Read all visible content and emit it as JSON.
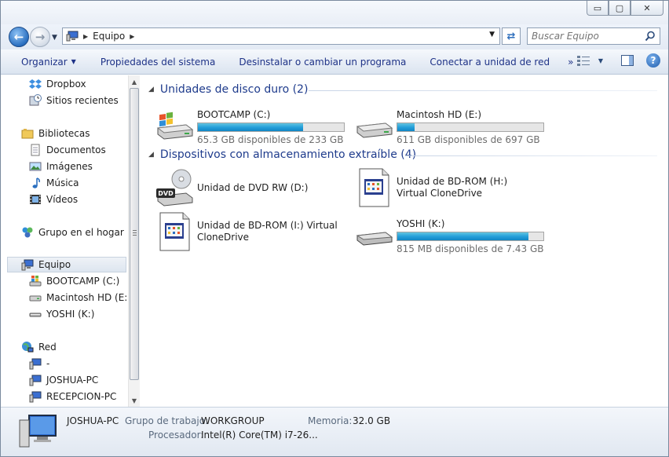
{
  "window": {
    "buttons": {
      "minimize": "▭",
      "maximize": "▢",
      "close": "✕"
    }
  },
  "address": {
    "back_icon": "back-arrow-icon",
    "forward_icon": "forward-arrow-icon",
    "path": "Equipo",
    "search_placeholder": "Buscar Equipo"
  },
  "commandbar": {
    "organize": "Organizar",
    "items": [
      "Propiedades del sistema",
      "Desinstalar o cambiar un programa",
      "Conectar a unidad de red"
    ],
    "more": "»"
  },
  "sidebar": {
    "favorites": [
      "Dropbox",
      "Sitios recientes"
    ],
    "libraries": {
      "label": "Bibliotecas",
      "items": [
        "Documentos",
        "Imágenes",
        "Música",
        "Vídeos"
      ]
    },
    "homegroup": "Grupo en el hogar",
    "computer": {
      "label": "Equipo",
      "items": [
        "BOOTCAMP (C:)",
        "Macintosh HD (E:)",
        "YOSHI (K:)"
      ]
    },
    "network": {
      "label": "Red",
      "items": [
        "-",
        "JOSHUA-PC",
        "RECEPCION-PC"
      ]
    }
  },
  "content": {
    "hdd_header": "Unidades de disco duro (2)",
    "removable_header": "Dispositivos con almacenamiento extraíble (4)",
    "drives": [
      {
        "name": "BOOTCAMP (C:)",
        "free": "65.3 GB disponibles de 233 GB",
        "used_fraction": 0.72
      },
      {
        "name": "Macintosh HD (E:)",
        "free": "611 GB disponibles de 697 GB",
        "used_fraction": 0.12
      }
    ],
    "removable": [
      {
        "name": "Unidad de DVD RW (D:)"
      },
      {
        "name": "Unidad de BD-ROM (H:) Virtual CloneDrive"
      },
      {
        "name": "Unidad de BD-ROM (I:) Virtual CloneDrive"
      },
      {
        "name": "YOSHI (K:)",
        "free": "815 MB disponibles de 7.43 GB",
        "used_fraction": 0.9
      }
    ],
    "dvd_label": "DVD"
  },
  "details": {
    "computer_name": "JOSHUA-PC",
    "workgroup_label": "Grupo de trabajo:",
    "workgroup": "WORKGROUP",
    "memory_label": "Memoria:",
    "memory": "32.0 GB",
    "processor_label": "Procesador:",
    "processor": "Intel(R) Core(TM) i7-26..."
  },
  "colors": {
    "accent": "#1e3b8c",
    "progress": "#26a0da",
    "link": "#1e3287"
  }
}
